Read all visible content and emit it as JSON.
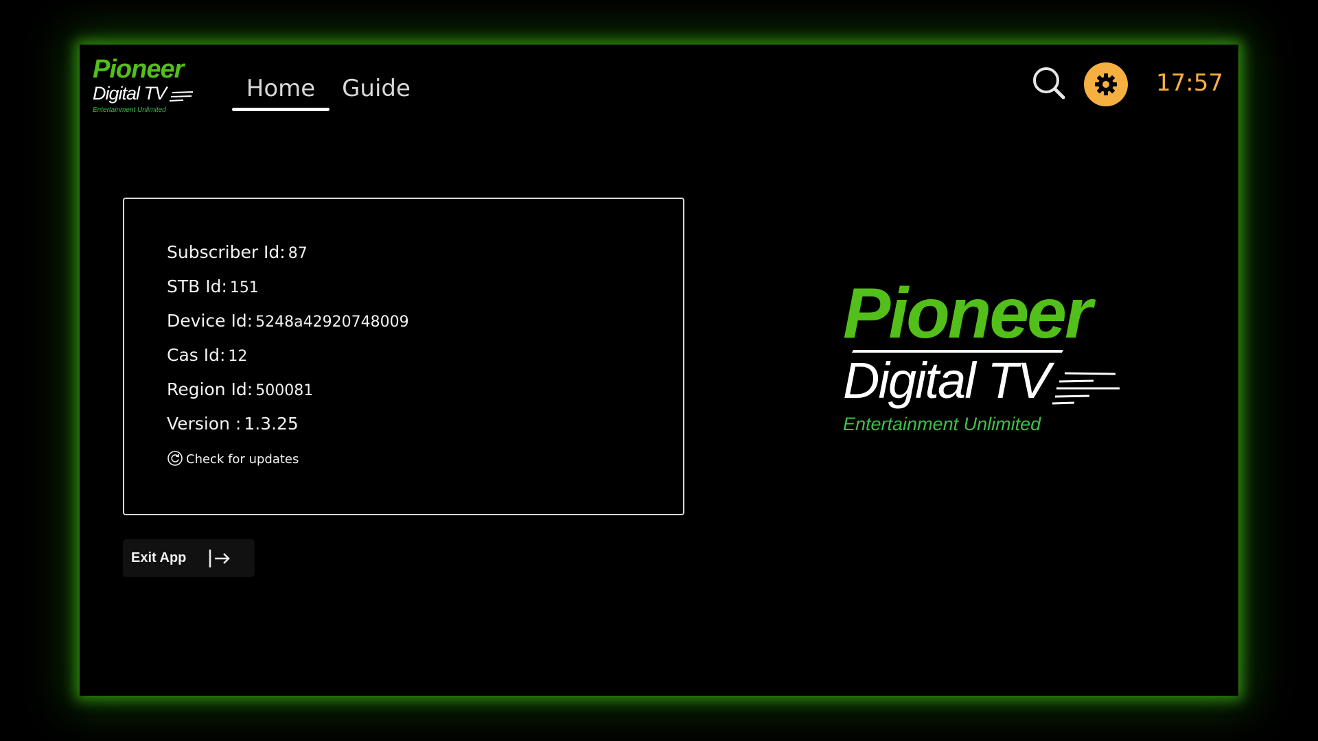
{
  "colors": {
    "brand_green": "#53bf1a",
    "tagline_green": "#3fbf4a",
    "accent_orange": "#f5b041",
    "glow_green": "#3caa14"
  },
  "header": {
    "logo": {
      "brand": "Pioneer",
      "product": "Digital TV",
      "tagline": "Entertainment Unlimited"
    },
    "tabs": [
      {
        "label": "Home",
        "active": true
      },
      {
        "label": "Guide",
        "active": false
      }
    ],
    "search_icon": "search-icon",
    "settings_icon": "gear-icon",
    "clock": "17:57"
  },
  "info": {
    "rows": [
      {
        "label": "Subscriber Id:",
        "value": "87"
      },
      {
        "label": "STB Id:",
        "value": "151"
      },
      {
        "label": "Device Id:",
        "value": "5248a42920748009"
      },
      {
        "label": "Cas Id:",
        "value": "12"
      },
      {
        "label": "Region Id:",
        "value": "500081"
      },
      {
        "label": "Version :",
        "value": "1.3.25"
      }
    ],
    "check_updates": "Check for updates",
    "check_updates_icon": "refresh-icon"
  },
  "exit": {
    "label": "Exit App",
    "icon": "exit-arrow-icon"
  },
  "big_logo": {
    "brand": "Pioneer",
    "product": "Digital TV",
    "tagline": "Entertainment Unlimited"
  }
}
